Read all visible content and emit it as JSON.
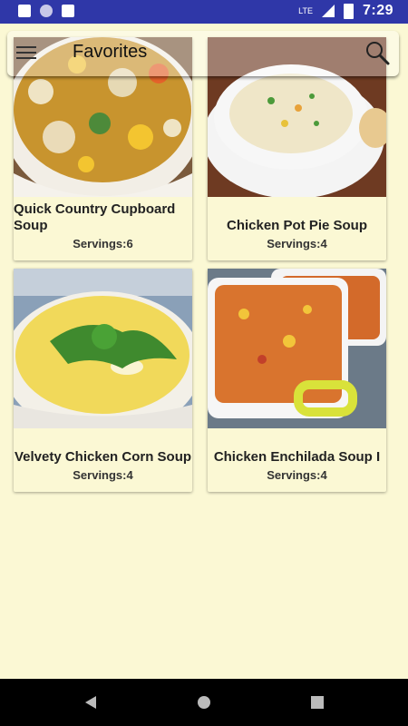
{
  "status_bar": {
    "network": "LTE",
    "time": "7:29"
  },
  "app_bar": {
    "title": "Favorites",
    "menu_icon": "hamburger-menu-icon",
    "search_icon": "search-icon"
  },
  "recipes": [
    {
      "title": "Quick Country Cupboard Soup",
      "servings": "Servings:6"
    },
    {
      "title": "Chicken Pot Pie Soup",
      "servings": "Servings:4"
    },
    {
      "title": "Velvety Chicken Corn Soup",
      "servings": "Servings:4"
    },
    {
      "title": "Chicken Enchilada Soup I",
      "servings": "Servings:4"
    }
  ],
  "nav_bar": {
    "back_icon": "back-triangle-icon",
    "home_icon": "home-circle-icon",
    "recents_icon": "recents-square-icon"
  },
  "colors": {
    "background": "#FBF8D4",
    "status_bar": "#2F37A8",
    "nav_bar": "#000000"
  }
}
